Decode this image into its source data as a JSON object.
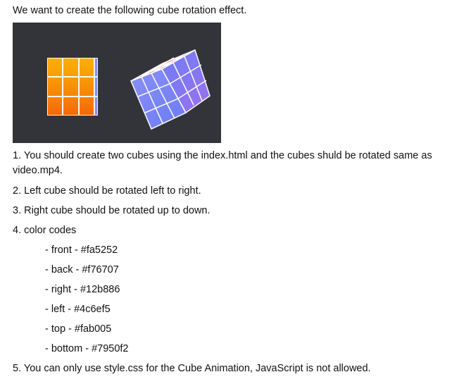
{
  "intro": "We want to create the following cube rotation effect.",
  "steps": [
    {
      "text": "1. You should create two cubes using the index.html and the cubes shuld be rotated same as video.mp4."
    },
    {
      "text": "2. Left cube should be rotated left to right."
    },
    {
      "text": "3. Right cube should be rotated up to down."
    },
    {
      "text": "4. color codes"
    }
  ],
  "color_codes": [
    {
      "text": "- front - #fa5252",
      "color": "#fa5252"
    },
    {
      "text": "- back - #f76707",
      "color": "#f76707"
    },
    {
      "text": "- right - #12b886",
      "color": "#12b886"
    },
    {
      "text": "- left - #4c6ef5",
      "color": "#4c6ef5"
    },
    {
      "text": "- top - #fab005",
      "color": "#fab005"
    },
    {
      "text": "- bottom - #7950f2",
      "color": "#7950f2"
    }
  ],
  "final_step": "5. You can only use style.css for the Cube Animation, JavaScript is not allowed.",
  "preview": {
    "background": "#323439",
    "left_cube_colors": [
      "#fab005",
      "#f76707",
      "#4c6ef5"
    ],
    "right_cube_colors": [
      "#fa5252",
      "#4c6ef5",
      "#7950f2"
    ]
  }
}
